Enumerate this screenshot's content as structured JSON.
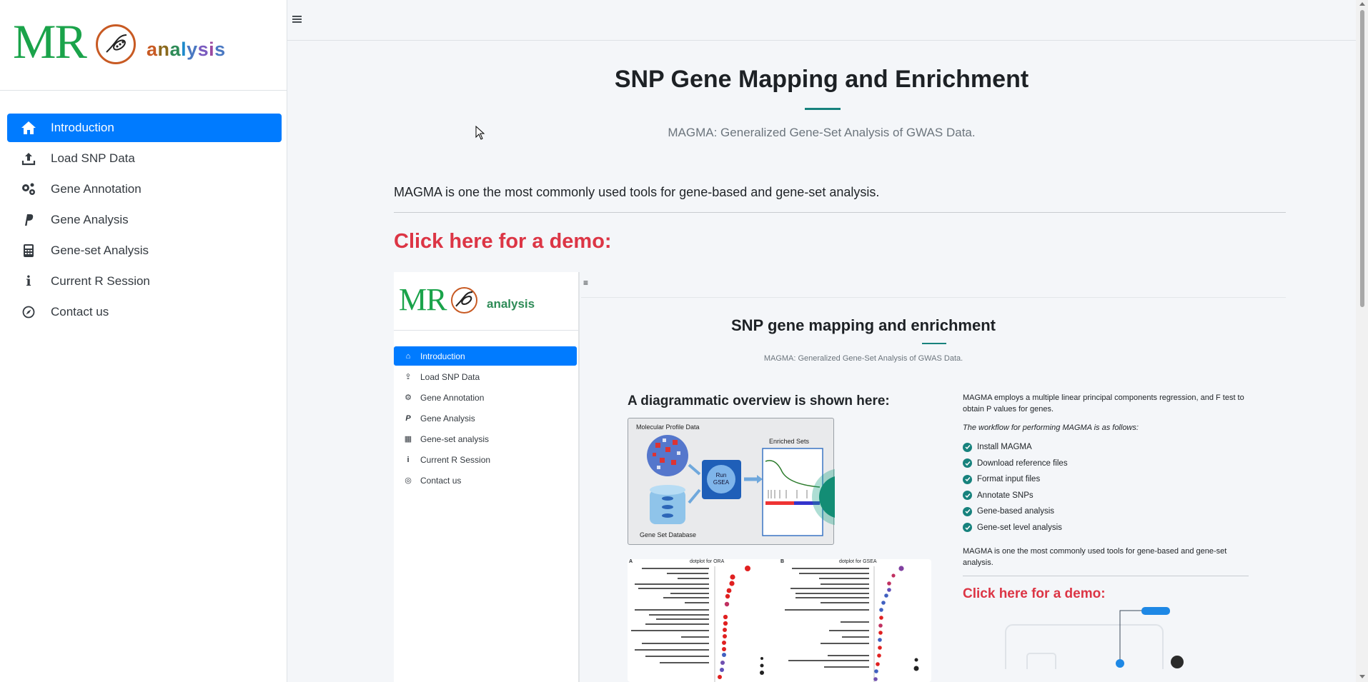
{
  "sidebar": {
    "logo_mr": "MR",
    "logo_analysis": [
      "a",
      "n",
      "a",
      "l",
      "y",
      "s",
      "i",
      "s"
    ],
    "items": [
      {
        "label": "Introduction",
        "icon": "home-icon",
        "active": true
      },
      {
        "label": "Load SNP Data",
        "icon": "upload-icon"
      },
      {
        "label": "Gene Annotation",
        "icon": "gears-icon"
      },
      {
        "label": "Gene Analysis",
        "icon": "paypal-icon"
      },
      {
        "label": "Gene-set Analysis",
        "icon": "calculator-icon"
      },
      {
        "label": "Current R Session",
        "icon": "info-icon"
      },
      {
        "label": "Contact us",
        "icon": "compass-icon"
      }
    ]
  },
  "topbar": {
    "menu_icon": "hamburger-icon"
  },
  "main": {
    "title": "SNP Gene Mapping and Enrichment",
    "subtitle": "MAGMA: Generalized Gene-Set Analysis of GWAS Data.",
    "intro": "MAGMA is one the most commonly used tools for gene-based and gene-set analysis.",
    "demo_heading": "Click here for a demo:"
  },
  "preview": {
    "logo_mr": "MR",
    "logo_analysis": "analysis",
    "items": [
      {
        "label": "Introduction",
        "active": true
      },
      {
        "label": "Load SNP Data"
      },
      {
        "label": "Gene Annotation"
      },
      {
        "label": "Gene Analysis"
      },
      {
        "label": "Gene-set analysis"
      },
      {
        "label": "Current R Session"
      },
      {
        "label": "Contact us"
      }
    ],
    "title": "SNP gene mapping and enrichment",
    "subtitle": "MAGMA: Generalized Gene-Set Analysis of GWAS Data.",
    "diagram_heading": "A diagrammatic overview is shown here:",
    "diagram": {
      "molecular": "Molecular Profile Data",
      "enriched": "Enriched Sets",
      "run": "Run GSEA",
      "database": "Gene Set Database"
    },
    "plots": {
      "a_title": "dotplot for ORA",
      "b_title": "dotplot for GSEA",
      "a_label": "A",
      "b_label": "B"
    },
    "right_intro": "MAGMA employs a multiple linear principal components regression, and F test to obtain P values for genes.",
    "workflow_label": "The workflow for performing MAGMA is as follows:",
    "workflow": [
      "Install MAGMA",
      "Download reference files",
      "Format input files",
      "Annotate SNPs",
      "Gene-based analysis",
      "Gene-set level analysis"
    ],
    "right_outro": "MAGMA is one the most commonly used tools for gene-based and gene-set analysis.",
    "demo_heading": "Click here for a demo:"
  },
  "colors": {
    "accent": "#007bff",
    "teal": "#17827d",
    "demo_red": "#dc3545",
    "logo_green": "#1aa34a",
    "logo_orange": "#c85a23"
  }
}
